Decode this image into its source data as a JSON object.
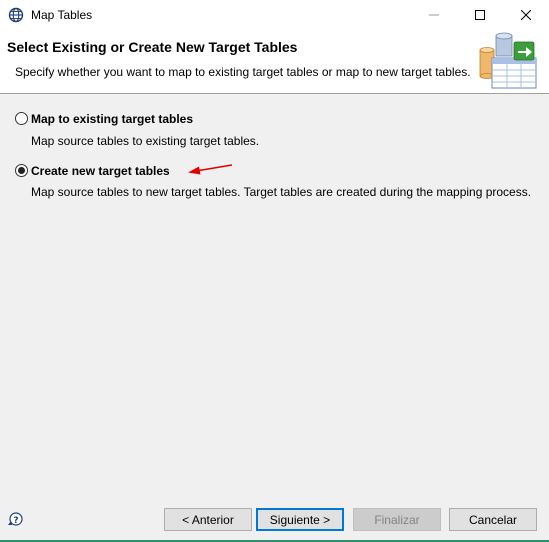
{
  "window": {
    "title": "Map Tables",
    "icons": {
      "app": "globe-icon",
      "minimize": "minimize-icon",
      "maximize": "maximize-icon",
      "close": "close-icon"
    }
  },
  "banner": {
    "title": "Select Existing or Create New Target Tables",
    "description": "Specify whether you want to map to existing target tables or map to new target tables.",
    "graphic": "database-tables-graphic"
  },
  "options": [
    {
      "label": "Map to existing target tables",
      "description": "Map source tables to existing target tables.",
      "selected": false
    },
    {
      "label": "Create new target tables",
      "description": "Map source tables to new target tables. Target tables are created during the mapping process.",
      "selected": true
    }
  ],
  "annotation": {
    "type": "red-arrow-icon",
    "color": "#e00000"
  },
  "footer": {
    "help_icon": "help-icon",
    "back_label": "< Anterior",
    "next_label": "Siguiente >",
    "finish_label": "Finalizar",
    "cancel_label": "Cancelar"
  },
  "colors": {
    "accent": "#0078d7",
    "bottom_border": "#2f8f6f"
  }
}
